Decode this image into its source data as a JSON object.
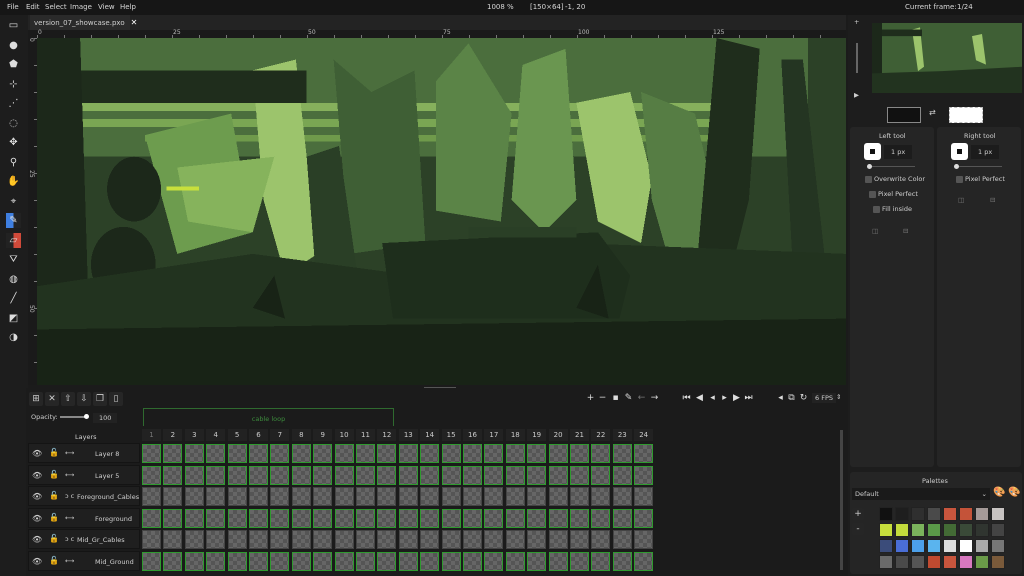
{
  "menu": [
    "File",
    "Edit",
    "Select",
    "Image",
    "View",
    "Help"
  ],
  "status": {
    "zoom": "1008 %",
    "size": "[150×64]",
    "cursor": "-1, 20",
    "current_frame_label": "Current frame:",
    "current_frame": "1/24"
  },
  "tab": {
    "title": "version_07_showcase.pxo",
    "close": "✕"
  },
  "ruler": {
    "top": [
      "0",
      "25",
      "50",
      "75",
      "100",
      "125"
    ],
    "left": [
      "0",
      "25",
      "50"
    ]
  },
  "tools": [
    "rectangle-select",
    "ellipse-select",
    "polygon-select",
    "color-select",
    "magic-wand",
    "lasso",
    "move",
    "zoom",
    "pan",
    "color-picker",
    "pencil",
    "eraser",
    "bucket",
    "shading",
    "line",
    "rectangle",
    "ellipse"
  ],
  "timeline": {
    "opacity_label": "Opacity:",
    "opacity": "100",
    "tag": "cable loop",
    "layers_header": "Layers",
    "fps": "6 FPS",
    "frames": [
      "1",
      "2",
      "3",
      "4",
      "5",
      "6",
      "7",
      "8",
      "9",
      "10",
      "11",
      "12",
      "13",
      "14",
      "15",
      "16",
      "17",
      "18",
      "19",
      "20",
      "21",
      "22",
      "23",
      "24"
    ],
    "layers": [
      {
        "name": "Layer 8",
        "linked": true,
        "link_icon": "⟷"
      },
      {
        "name": "Layer 5",
        "linked": true,
        "link_icon": "⟷"
      },
      {
        "name": "Foreground_Cables",
        "linked": false,
        "link_icon": "ↄ c"
      },
      {
        "name": "Foreground",
        "linked": true,
        "link_icon": "⟷"
      },
      {
        "name": "Mid_Gr_Cables",
        "linked": false,
        "link_icon": "ↄ c"
      },
      {
        "name": "Mid_Ground",
        "linked": true,
        "link_icon": "⟷"
      }
    ]
  },
  "tools_panel": {
    "left_title": "Left tool",
    "right_title": "Right tool",
    "left_size": "1 px",
    "right_size": "1 px",
    "overwrite": "Overwrite Color",
    "pixel_perfect": "Pixel Perfect",
    "fill_inside": "Fill inside",
    "left_color": "#111111",
    "right_color": "#ffffff"
  },
  "palettes": {
    "title": "Palettes",
    "selected": "Default",
    "add": "+",
    "remove": "-",
    "colors": [
      "#111111",
      "#1e1e1e",
      "#2f2f2f",
      "#4a4a4a",
      "#c8553d",
      "#c45339",
      "#a59a98",
      "#c8c4c2",
      "#c8e03c",
      "#c4dc3c",
      "#7bb35c",
      "#5a9a48",
      "#436b35",
      "#3a4a38",
      "#303530",
      "#444444",
      "#3b4c7a",
      "#4a6ed6",
      "#4ca0ea",
      "#5ab4ee",
      "#dddddd",
      "#ffffff",
      "#aaaaaa",
      "#777777",
      "#6a6a6a",
      "#4a4a4a",
      "#555555",
      "#c04a30",
      "#c8553d",
      "#d878c0",
      "#6a9a48",
      "#7a5a3a"
    ]
  }
}
